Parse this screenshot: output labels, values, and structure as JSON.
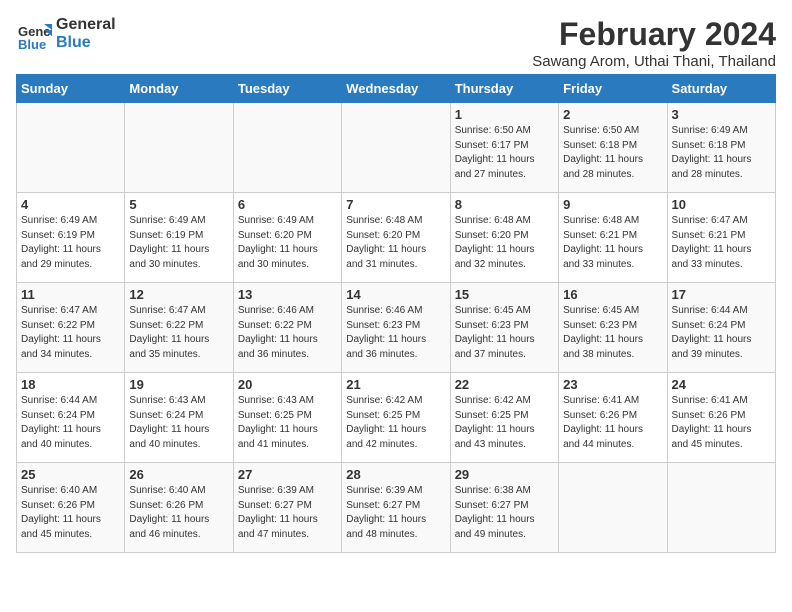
{
  "logo": {
    "line1": "General",
    "line2": "Blue"
  },
  "title": "February 2024",
  "subtitle": "Sawang Arom, Uthai Thani, Thailand",
  "days_header": [
    "Sunday",
    "Monday",
    "Tuesday",
    "Wednesday",
    "Thursday",
    "Friday",
    "Saturday"
  ],
  "weeks": [
    [
      {
        "day": "",
        "info": ""
      },
      {
        "day": "",
        "info": ""
      },
      {
        "day": "",
        "info": ""
      },
      {
        "day": "",
        "info": ""
      },
      {
        "day": "1",
        "info": "Sunrise: 6:50 AM\nSunset: 6:17 PM\nDaylight: 11 hours\nand 27 minutes."
      },
      {
        "day": "2",
        "info": "Sunrise: 6:50 AM\nSunset: 6:18 PM\nDaylight: 11 hours\nand 28 minutes."
      },
      {
        "day": "3",
        "info": "Sunrise: 6:49 AM\nSunset: 6:18 PM\nDaylight: 11 hours\nand 28 minutes."
      }
    ],
    [
      {
        "day": "4",
        "info": "Sunrise: 6:49 AM\nSunset: 6:19 PM\nDaylight: 11 hours\nand 29 minutes."
      },
      {
        "day": "5",
        "info": "Sunrise: 6:49 AM\nSunset: 6:19 PM\nDaylight: 11 hours\nand 30 minutes."
      },
      {
        "day": "6",
        "info": "Sunrise: 6:49 AM\nSunset: 6:20 PM\nDaylight: 11 hours\nand 30 minutes."
      },
      {
        "day": "7",
        "info": "Sunrise: 6:48 AM\nSunset: 6:20 PM\nDaylight: 11 hours\nand 31 minutes."
      },
      {
        "day": "8",
        "info": "Sunrise: 6:48 AM\nSunset: 6:20 PM\nDaylight: 11 hours\nand 32 minutes."
      },
      {
        "day": "9",
        "info": "Sunrise: 6:48 AM\nSunset: 6:21 PM\nDaylight: 11 hours\nand 33 minutes."
      },
      {
        "day": "10",
        "info": "Sunrise: 6:47 AM\nSunset: 6:21 PM\nDaylight: 11 hours\nand 33 minutes."
      }
    ],
    [
      {
        "day": "11",
        "info": "Sunrise: 6:47 AM\nSunset: 6:22 PM\nDaylight: 11 hours\nand 34 minutes."
      },
      {
        "day": "12",
        "info": "Sunrise: 6:47 AM\nSunset: 6:22 PM\nDaylight: 11 hours\nand 35 minutes."
      },
      {
        "day": "13",
        "info": "Sunrise: 6:46 AM\nSunset: 6:22 PM\nDaylight: 11 hours\nand 36 minutes."
      },
      {
        "day": "14",
        "info": "Sunrise: 6:46 AM\nSunset: 6:23 PM\nDaylight: 11 hours\nand 36 minutes."
      },
      {
        "day": "15",
        "info": "Sunrise: 6:45 AM\nSunset: 6:23 PM\nDaylight: 11 hours\nand 37 minutes."
      },
      {
        "day": "16",
        "info": "Sunrise: 6:45 AM\nSunset: 6:23 PM\nDaylight: 11 hours\nand 38 minutes."
      },
      {
        "day": "17",
        "info": "Sunrise: 6:44 AM\nSunset: 6:24 PM\nDaylight: 11 hours\nand 39 minutes."
      }
    ],
    [
      {
        "day": "18",
        "info": "Sunrise: 6:44 AM\nSunset: 6:24 PM\nDaylight: 11 hours\nand 40 minutes."
      },
      {
        "day": "19",
        "info": "Sunrise: 6:43 AM\nSunset: 6:24 PM\nDaylight: 11 hours\nand 40 minutes."
      },
      {
        "day": "20",
        "info": "Sunrise: 6:43 AM\nSunset: 6:25 PM\nDaylight: 11 hours\nand 41 minutes."
      },
      {
        "day": "21",
        "info": "Sunrise: 6:42 AM\nSunset: 6:25 PM\nDaylight: 11 hours\nand 42 minutes."
      },
      {
        "day": "22",
        "info": "Sunrise: 6:42 AM\nSunset: 6:25 PM\nDaylight: 11 hours\nand 43 minutes."
      },
      {
        "day": "23",
        "info": "Sunrise: 6:41 AM\nSunset: 6:26 PM\nDaylight: 11 hours\nand 44 minutes."
      },
      {
        "day": "24",
        "info": "Sunrise: 6:41 AM\nSunset: 6:26 PM\nDaylight: 11 hours\nand 45 minutes."
      }
    ],
    [
      {
        "day": "25",
        "info": "Sunrise: 6:40 AM\nSunset: 6:26 PM\nDaylight: 11 hours\nand 45 minutes."
      },
      {
        "day": "26",
        "info": "Sunrise: 6:40 AM\nSunset: 6:26 PM\nDaylight: 11 hours\nand 46 minutes."
      },
      {
        "day": "27",
        "info": "Sunrise: 6:39 AM\nSunset: 6:27 PM\nDaylight: 11 hours\nand 47 minutes."
      },
      {
        "day": "28",
        "info": "Sunrise: 6:39 AM\nSunset: 6:27 PM\nDaylight: 11 hours\nand 48 minutes."
      },
      {
        "day": "29",
        "info": "Sunrise: 6:38 AM\nSunset: 6:27 PM\nDaylight: 11 hours\nand 49 minutes."
      },
      {
        "day": "",
        "info": ""
      },
      {
        "day": "",
        "info": ""
      }
    ]
  ]
}
